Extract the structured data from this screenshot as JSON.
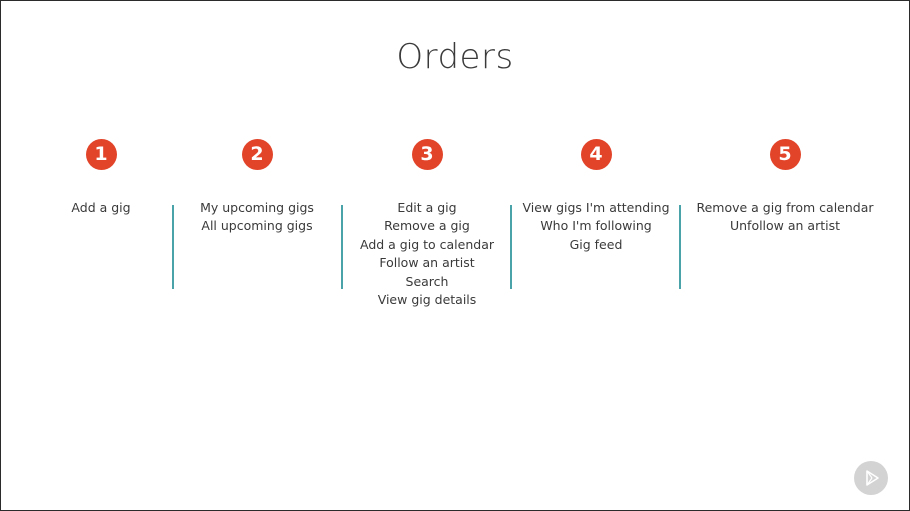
{
  "slide": {
    "title": "Orders"
  },
  "columns": [
    {
      "number": "1",
      "items": [
        "Add a gig"
      ]
    },
    {
      "number": "2",
      "items": [
        "My upcoming gigs",
        "All upcoming gigs"
      ]
    },
    {
      "number": "3",
      "items": [
        "Edit a gig",
        "Remove a gig",
        "Add a gig to calendar",
        "Follow an artist",
        "Search",
        "View gig details"
      ]
    },
    {
      "number": "4",
      "items": [
        "View gigs I'm attending",
        "Who I'm following",
        "Gig feed"
      ]
    },
    {
      "number": "5",
      "items": [
        "Remove a gig from calendar",
        "Unfollow an artist"
      ]
    }
  ],
  "colors": {
    "badge": "#e2442a",
    "divider": "#4aa3a8",
    "text": "#3a3a3a"
  },
  "player": {
    "icon": "play-icon"
  }
}
